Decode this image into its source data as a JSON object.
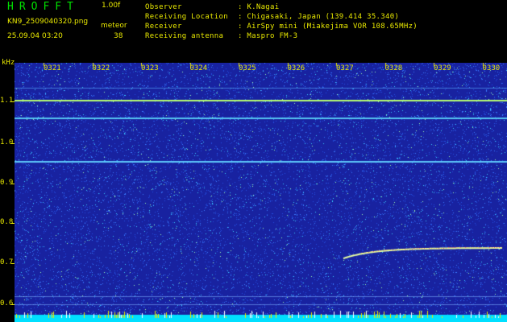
{
  "header": {
    "app_title": "HROFFT",
    "version": "1.00f",
    "filename": "KN9_2509040320.png",
    "meteor_label": "meteor",
    "datetime": "25.09.04 03:20",
    "meteor_count": "38",
    "info": [
      {
        "label": "Observer",
        "value": ": K.Nagai"
      },
      {
        "label": "Receiving Location",
        "value": ": Chigasaki, Japan (139.414 35.340)"
      },
      {
        "label": "Receiver",
        "value": ": AirSpy mini (Miakejima VOR 108.65MHz)"
      },
      {
        "label": "Receiving antenna",
        "value": ": Maspro FM-3"
      }
    ]
  },
  "spectrogram": {
    "y_unit": "kHz",
    "y_ticks": [
      "1.1",
      "1.0",
      "0.9",
      "0.8",
      "0.7",
      "0.6"
    ],
    "x_ticks": [
      "0321",
      "0322",
      "0323",
      "0324",
      "0325",
      "0326",
      "0327",
      "0328",
      "0329",
      "0330"
    ],
    "colors": {
      "background": "#1822a0",
      "noise": "#2a6cff",
      "line": "#c8ff60",
      "baseline": "#00e0ff",
      "label": "#e8e800"
    }
  }
}
